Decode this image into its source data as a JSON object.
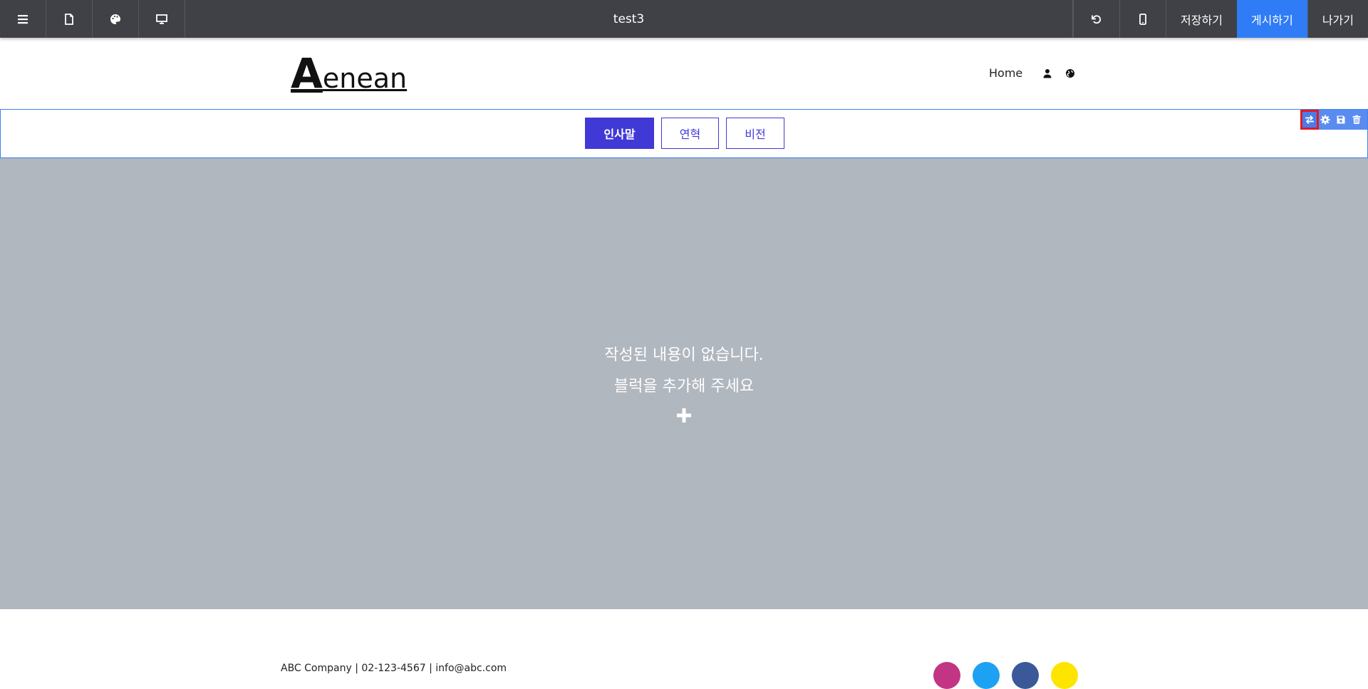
{
  "toolbar": {
    "title": "test3",
    "save_label": "저장하기",
    "publish_label": "게시하기",
    "exit_label": "나가기",
    "left_icons": [
      "menu-icon",
      "page-icon",
      "palette-icon",
      "desktop-icon"
    ],
    "right_icons": [
      "undo-icon",
      "mobile-icon"
    ]
  },
  "header": {
    "logo_cap": "A",
    "logo_rest": "enean",
    "nav_home": "Home",
    "nav_icons": [
      "user-icon",
      "globe-icon"
    ]
  },
  "tabs": [
    {
      "label": "인사말",
      "active": true
    },
    {
      "label": "연혁",
      "active": false
    },
    {
      "label": "비전",
      "active": false
    }
  ],
  "block_tools": [
    "swap-icon",
    "gear-icon",
    "save-icon",
    "trash-icon"
  ],
  "empty_state": {
    "line1": "작성된 내용이 없습니다.",
    "line2": "블럭을 추가해 주세요"
  },
  "footer": {
    "info": "ABC Company | 02-123-4567 | info@abc.com",
    "social_colors": [
      "#c13584",
      "#1da1f2",
      "#3b5998",
      "#fee500"
    ]
  },
  "colors": {
    "toolbar_bg": "#3f4146",
    "primary": "#2f7cf6",
    "tab_accent": "#4139d6",
    "empty_bg": "#b1b7bf"
  }
}
